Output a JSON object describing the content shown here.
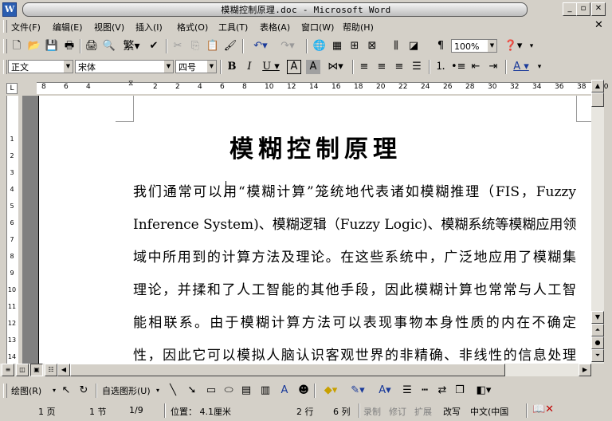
{
  "window": {
    "title": "模糊控制原理.doc - Microsoft Word",
    "app_icon": "W"
  },
  "menu": [
    "文件(F)",
    "编辑(E)",
    "视图(V)",
    "插入(I)",
    "格式(O)",
    "工具(T)",
    "表格(A)",
    "窗口(W)",
    "帮助(H)"
  ],
  "toolbar": {
    "zoom": "100%"
  },
  "format": {
    "style": "正文",
    "font": "宋体",
    "size": "四号"
  },
  "ruler_numbers": [
    "8",
    "6",
    "4",
    "2",
    "2",
    "4",
    "6",
    "8",
    "10",
    "12",
    "14",
    "16",
    "18",
    "20",
    "22",
    "24",
    "26",
    "28",
    "30",
    "32",
    "34",
    "36",
    "38",
    "40"
  ],
  "vruler_numbers": [
    "1",
    "2",
    "3",
    "4",
    "5",
    "6",
    "7",
    "8",
    "9",
    "10",
    "11",
    "12",
    "13",
    "14"
  ],
  "document": {
    "title": "模糊控制原理",
    "lines": [
      "我们通常可以用“模糊计算”笼统地代表诸如模糊推理（FIS，Fuzzy",
      "Inference System)、模糊逻辑（Fuzzy Logic)、模糊系统等模糊应用领",
      "域中所用到的计算方法及理论。在这些系统中，广泛地应用了模糊集",
      "理论，并揉和了人工智能的其他手段，因此模糊计算也常常与人工智",
      "能相联系。由于模糊计算方法可以表现事物本身性质的内在不确定",
      "性，因此它可以模拟人脑认识客观世界的非精确、非线性的信息处理"
    ]
  },
  "drawing": {
    "draw_label": "绘图(R)",
    "autoshapes_label": "自选图形(U)"
  },
  "status": {
    "page": "1 页",
    "section": "1 节",
    "page_of": "1/9",
    "position": "位置： 4.1厘米",
    "line": "2 行",
    "column": "6 列",
    "rec": "录制",
    "trk": "修订",
    "ext": "扩展",
    "ovr": "改写",
    "lang": "中文(中国"
  }
}
